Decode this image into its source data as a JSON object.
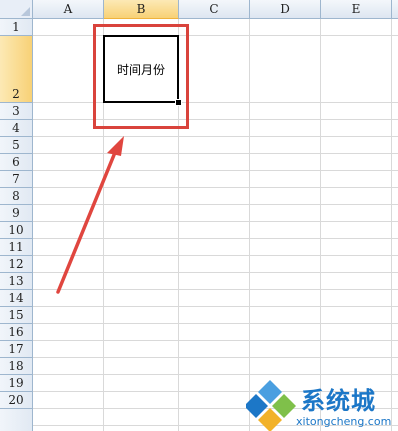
{
  "columns": [
    "A",
    "B",
    "C",
    "D",
    "E"
  ],
  "selected_column": "B",
  "rows": [
    "1",
    "2",
    "3",
    "4",
    "5",
    "6",
    "7",
    "8",
    "9",
    "10",
    "11",
    "12",
    "13",
    "14",
    "15",
    "16",
    "17",
    "18",
    "19",
    "20"
  ],
  "selected_row": "2",
  "cell_b2": {
    "text": "时间月份"
  },
  "annotation": {
    "box_color": "#d9433c",
    "arrow_color": "#e0463f"
  },
  "watermark": {
    "brand": "系统城",
    "site": "xitongcheng.com",
    "color": "#1c77c7"
  }
}
